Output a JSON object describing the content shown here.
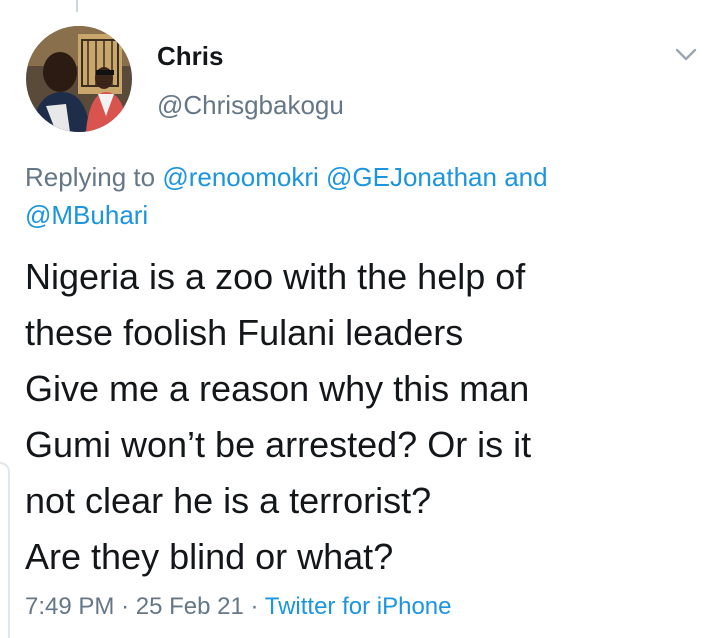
{
  "tweet": {
    "author": {
      "display_name": "Chris",
      "handle": "@Chrisgbakogu",
      "avatar_icon": "profile-photo"
    },
    "menu_icon": "chevron-down-icon",
    "reply_context": {
      "prefix": "Replying to",
      "mention_1": "@renoomokri",
      "mention_2": "@GEJonathan",
      "conjunction": "and",
      "mention_3": "@MBuhari"
    },
    "text_lines": [
      "Nigeria is a zoo with the help of",
      "these foolish Fulani leaders",
      "Give me a reason why this man",
      "Gumi won’t be arrested? Or is it",
      "not clear he is a terrorist?",
      "Are they blind or what?"
    ],
    "time": "7:49 PM",
    "separator": "·",
    "date": "25 Feb 21",
    "source": "Twitter for iPhone"
  },
  "colors": {
    "text_primary": "#14171a",
    "text_secondary": "#657786",
    "link": "#1b95e0"
  }
}
